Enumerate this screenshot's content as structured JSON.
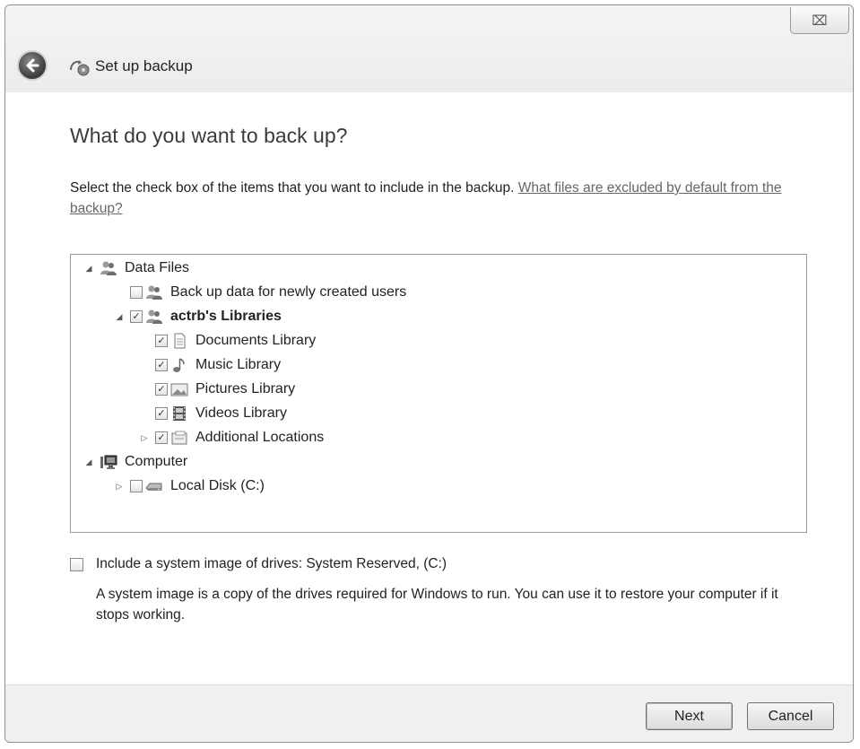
{
  "window": {
    "title": "Set up backup",
    "close_glyph": "⌧"
  },
  "page": {
    "heading": "What do you want to back up?",
    "instructions": "Select the check box of the items that you want to include in the backup.",
    "help_link": "What files are excluded by default from the backup?"
  },
  "tree": {
    "items": [
      {
        "label": "Data Files",
        "level": 0,
        "expander": "expanded",
        "checkbox": null,
        "icon": "users-icon",
        "bold": false
      },
      {
        "label": "Back up data for newly created users",
        "level": 1,
        "expander": null,
        "checkbox": false,
        "icon": "users-icon",
        "bold": false
      },
      {
        "label": "actrb's Libraries",
        "level": 1,
        "expander": "expanded",
        "checkbox": true,
        "icon": "users-icon",
        "bold": true
      },
      {
        "label": "Documents Library",
        "level": 2,
        "expander": null,
        "checkbox": true,
        "icon": "document-icon",
        "bold": false
      },
      {
        "label": "Music Library",
        "level": 2,
        "expander": null,
        "checkbox": true,
        "icon": "music-icon",
        "bold": false
      },
      {
        "label": "Pictures Library",
        "level": 2,
        "expander": null,
        "checkbox": true,
        "icon": "picture-icon",
        "bold": false
      },
      {
        "label": "Videos Library",
        "level": 2,
        "expander": null,
        "checkbox": true,
        "icon": "film-icon",
        "bold": false
      },
      {
        "label": "Additional Locations",
        "level": 2,
        "expander": "collapsed",
        "checkbox": true,
        "icon": "folder-icon",
        "bold": false
      },
      {
        "label": "Computer",
        "level": 0,
        "expander": "expanded",
        "checkbox": null,
        "icon": "computer-icon",
        "bold": false
      },
      {
        "label": "Local Disk (C:)",
        "level": 1,
        "expander": "collapsed",
        "checkbox": false,
        "icon": "disk-icon",
        "bold": false
      }
    ]
  },
  "system_image": {
    "label": "Include a system image of drives: System Reserved, (C:)",
    "checked": false,
    "description": "A system image is a copy of the drives required for Windows to run. You can use it to restore your computer if it stops working."
  },
  "buttons": {
    "next": "Next",
    "cancel": "Cancel"
  }
}
